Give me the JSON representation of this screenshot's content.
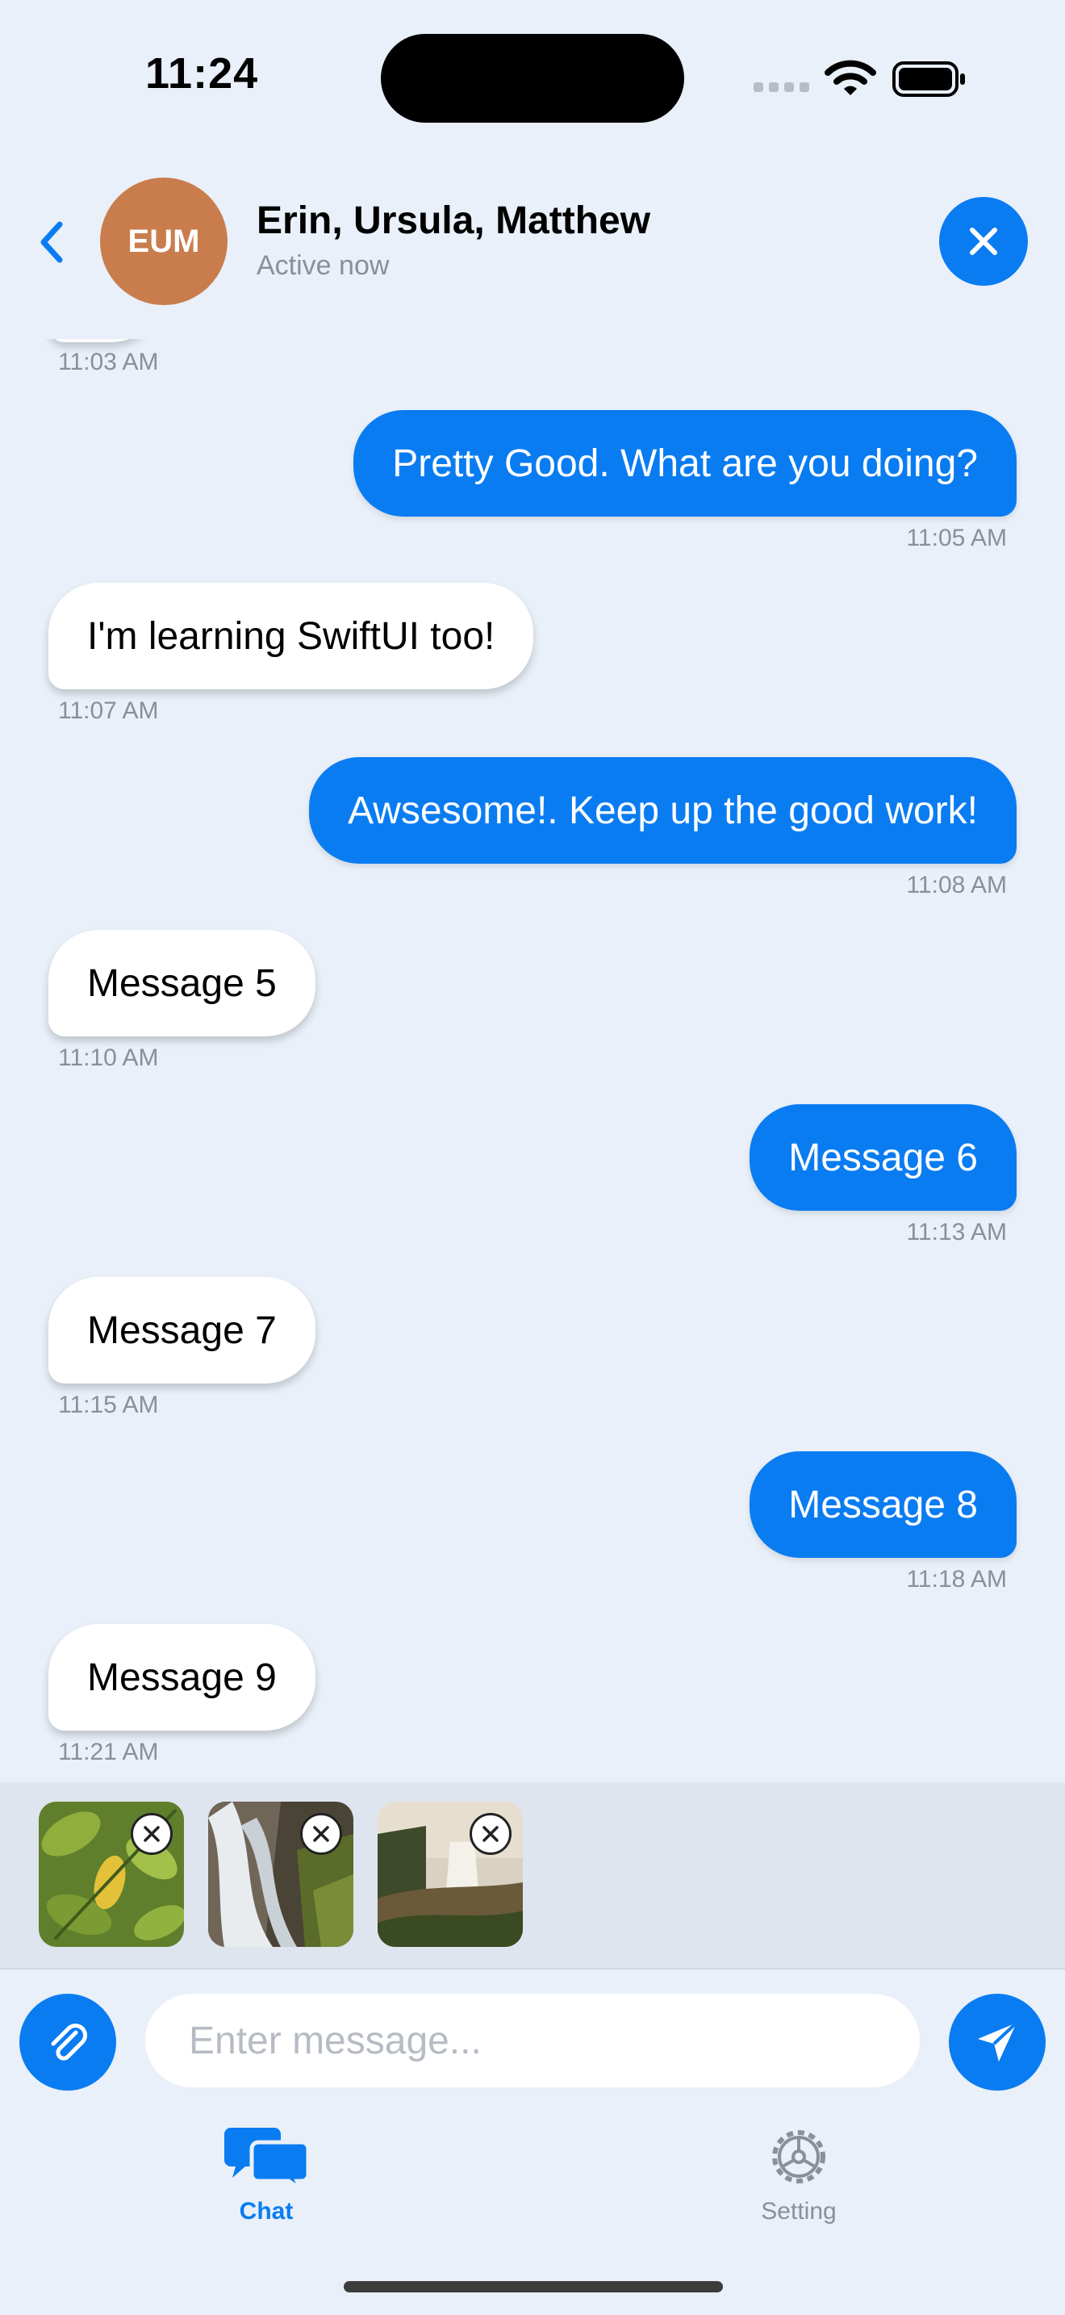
{
  "status_bar": {
    "time": "11:24"
  },
  "header": {
    "avatar_initials": "EUM",
    "title": "Erin, Ursula, Matthew",
    "subtitle": "Active now"
  },
  "messages": [
    {
      "text": "",
      "time": "11:03 AM",
      "direction": "incoming"
    },
    {
      "text": "Pretty Good. What are you doing?",
      "time": "11:05 AM",
      "direction": "outgoing"
    },
    {
      "text": "I'm learning SwiftUI too!",
      "time": "11:07 AM",
      "direction": "incoming"
    },
    {
      "text": "Awsesome!. Keep up the good work!",
      "time": "11:08 AM",
      "direction": "outgoing"
    },
    {
      "text": "Message 5",
      "time": "11:10 AM",
      "direction": "incoming"
    },
    {
      "text": "Message 6",
      "time": "11:13 AM",
      "direction": "outgoing"
    },
    {
      "text": "Message 7",
      "time": "11:15 AM",
      "direction": "incoming"
    },
    {
      "text": "Message 8",
      "time": "11:18 AM",
      "direction": "outgoing"
    },
    {
      "text": "Message 9",
      "time": "11:21 AM",
      "direction": "incoming"
    }
  ],
  "attachments": [
    {
      "icon": "leaf-photo"
    },
    {
      "icon": "waterfall-photo"
    },
    {
      "icon": "landscape-photo"
    }
  ],
  "composer": {
    "placeholder": "Enter message..."
  },
  "tabs": [
    {
      "label": "Chat",
      "icon": "chat-bubbles-icon",
      "selected": true
    },
    {
      "label": "Setting",
      "icon": "gear-icon",
      "selected": false
    }
  ],
  "colors": {
    "accent": "#0a7cf2",
    "background": "#e9f0f9",
    "avatar": "#c97d4d"
  }
}
